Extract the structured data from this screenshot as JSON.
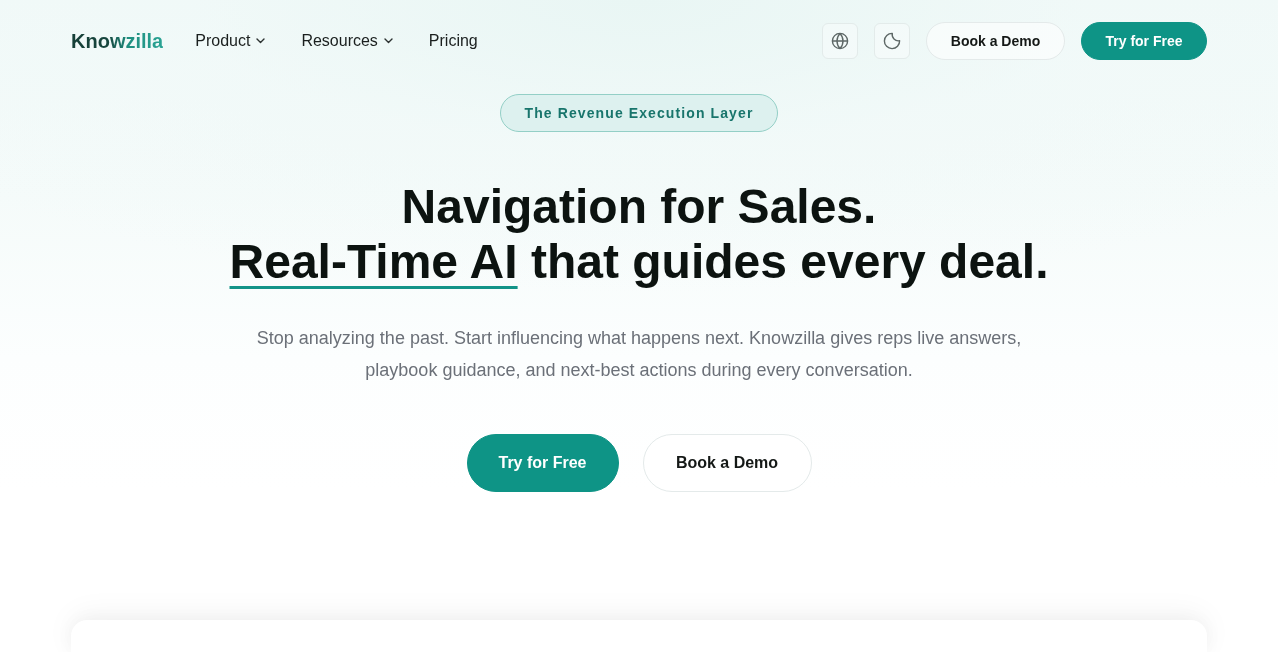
{
  "nav": {
    "logo": "Knowzilla",
    "links": [
      {
        "label": "Product",
        "has_menu": true
      },
      {
        "label": "Resources",
        "has_menu": true
      },
      {
        "label": "Pricing",
        "has_menu": false
      }
    ],
    "buttons": [
      {
        "label": "Book a Demo",
        "kind": "secondary"
      },
      {
        "label": "Try for Free",
        "kind": "primary"
      }
    ]
  },
  "hero": {
    "badge": "The Revenue Execution Layer",
    "headline": {
      "line_1": "Navigation for Sales.",
      "highlight": "Real-Time AI",
      "line_2_rest": "that guides every deal."
    },
    "description": "Stop analyzing the past. Start influencing what happens next. Knowzilla gives reps live answers, playbook guidance, and next-best actions during every conversation.",
    "buttons": [
      {
        "label": "Try for Free",
        "kind": "primary"
      },
      {
        "label": "Book a Demo",
        "kind": "secondary"
      }
    ]
  }
}
